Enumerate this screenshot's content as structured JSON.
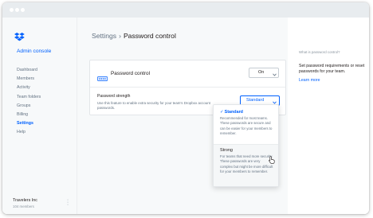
{
  "app": {
    "console_title": "Admin console",
    "accent_color": "#0061fe"
  },
  "sidebar": {
    "items": [
      {
        "label": "Dashboard"
      },
      {
        "label": "Members"
      },
      {
        "label": "Activity"
      },
      {
        "label": "Team folders"
      },
      {
        "label": "Groups"
      },
      {
        "label": "Billing"
      },
      {
        "label": "Settings",
        "active": true
      },
      {
        "label": "Help"
      }
    ],
    "team": {
      "name": "Travelers Inc",
      "members": "104 members"
    }
  },
  "header": {
    "breadcrumb_root": "Settings",
    "breadcrumb_separator": "›",
    "title": "Password control",
    "icons": [
      "bell-icon",
      "avatar"
    ]
  },
  "password_control": {
    "label": "Password control",
    "toggle_value": "On",
    "strength_label": "Password strength",
    "strength_description": "Use this feature to enable extra security for your team's Dropbox account passwords.",
    "strength_value": "Standard"
  },
  "dropdown": {
    "options": [
      {
        "name": "Standard",
        "selected": true,
        "description": "Recommended for most teams. These passwords are secure and can be easier for your members to remember."
      },
      {
        "name": "Strong",
        "selected": false,
        "description": "For teams that need more security. These passwords are very complex but might be more difficult for your members to remember."
      }
    ]
  },
  "help_panel": {
    "question": "What is password control?",
    "text": "Set password requirements or reset passwords for your team.",
    "link": "Learn more"
  }
}
